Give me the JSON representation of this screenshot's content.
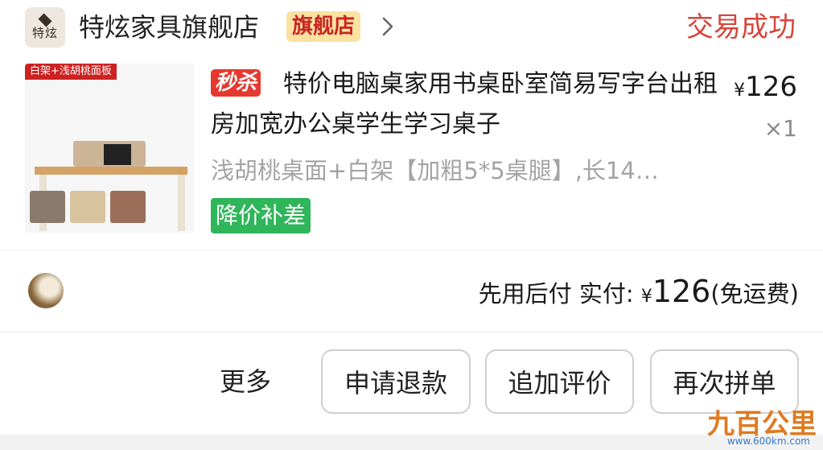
{
  "shop": {
    "logo_text": "特炫",
    "name": "特炫家具旗舰店",
    "badge": "旗舰店",
    "status": "交易成功"
  },
  "product": {
    "image_tag": "白架+浅胡桃面板",
    "seckill_badge": "秒杀",
    "title": "特价电脑桌家用书桌卧室简易写字台出租房加宽办公桌学生学习桌子",
    "price_symbol": "¥",
    "price": "126",
    "quantity": "×1",
    "spec": "浅胡桃桌面+白架【加粗5*5桌腿】,长14…",
    "promo_tag": "降价补差"
  },
  "payment": {
    "method": "先用后付",
    "label": "实付:",
    "symbol": "¥",
    "amount": "126",
    "shipping_note": "(免运费)"
  },
  "actions": {
    "more": "更多",
    "refund": "申请退款",
    "add_review": "追加评价",
    "reorder": "再次拼单"
  },
  "watermark": {
    "main": "九百公里",
    "url": "www.600km.com"
  },
  "colors": {
    "status_red": "#d6463a",
    "badge_bg": "#fbe2a2",
    "seckill_red": "#e5392f",
    "promo_green": "#2fb55a"
  }
}
